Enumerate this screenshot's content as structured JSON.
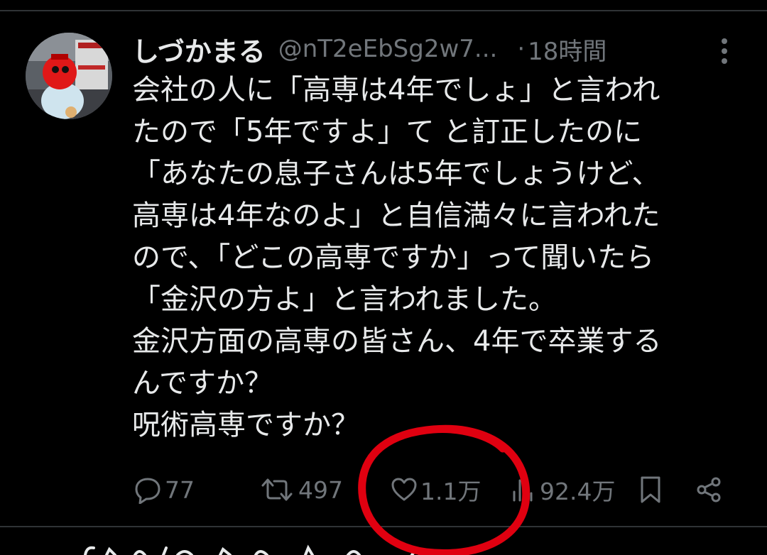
{
  "tweet": {
    "display_name": "しづかまる",
    "handle": "@nT2eEbSg2w7...",
    "separator": "·",
    "time": "18時間",
    "body": "会社の人に「高専は4年でしょ」と言われ\nたので「5年ですよ」て と訂正したのに\n「あなたの息子さんは5年でしょうけど、\n高専は4年なのよ」と自信満々に言われた\nので、「どこの高専ですか」って聞いたら\n「金沢の方よ」と言われました。\n金沢方面の高専の皆さん、4年で卒業する\nんですか？\n呪術高専ですか？"
  },
  "actions": {
    "reply": {
      "icon": "reply-icon",
      "count": "77"
    },
    "retweet": {
      "icon": "retweet-icon",
      "count": "497"
    },
    "like": {
      "icon": "heart-icon",
      "count": "1.1万"
    },
    "views": {
      "icon": "bar-chart-icon",
      "count": "92.4万"
    },
    "bookmark": {
      "icon": "bookmark-icon"
    },
    "share": {
      "icon": "share-icon"
    }
  },
  "colors": {
    "background": "#000000",
    "text_primary": "#e7e9ea",
    "text_secondary": "#71767b",
    "divider": "#2f3336",
    "annotation": "#e00010"
  }
}
